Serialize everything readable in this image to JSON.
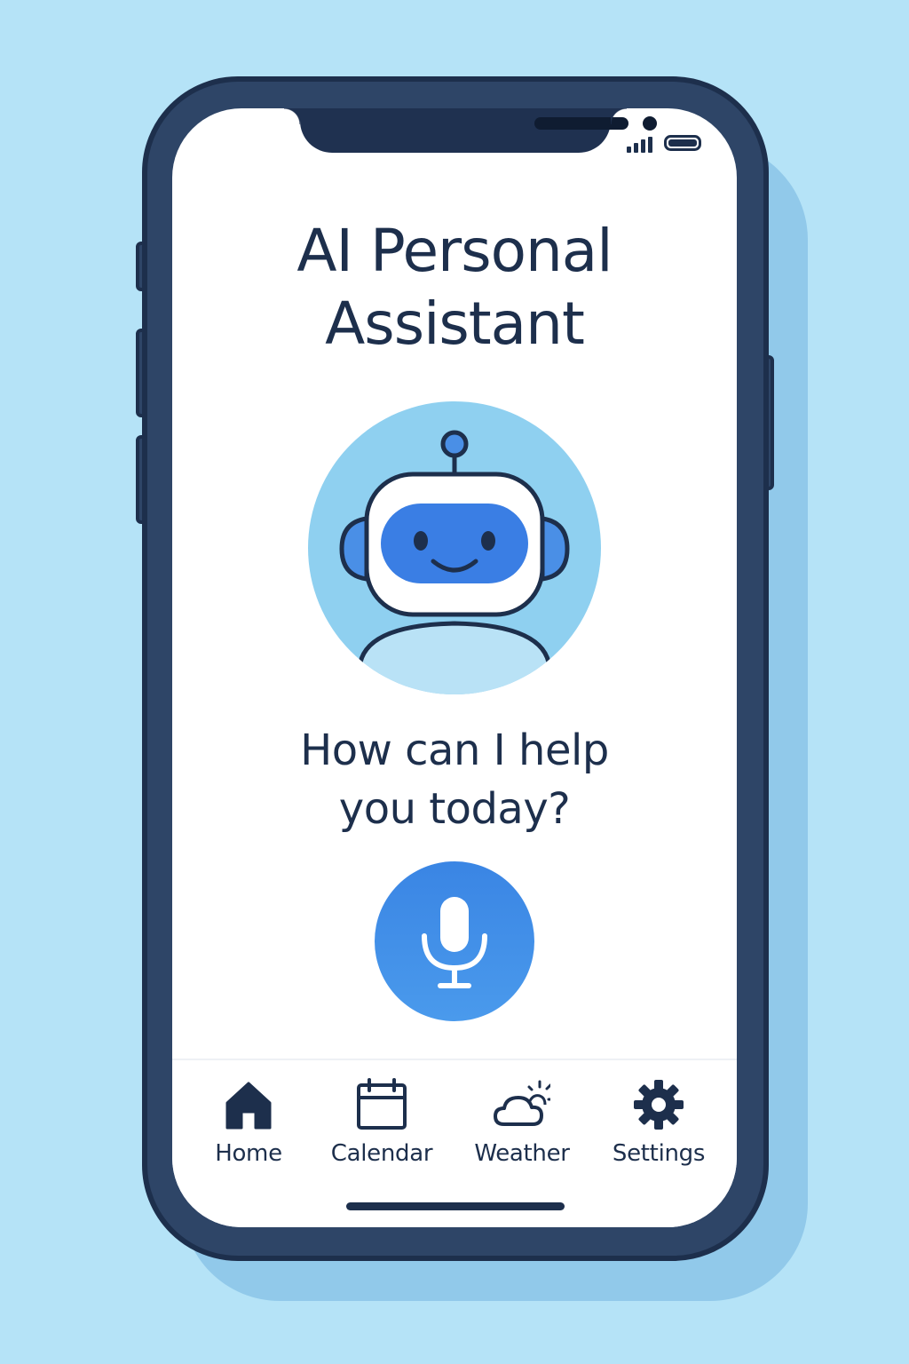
{
  "app": {
    "title_line1": "AI Personal",
    "title_line2": "Assistant"
  },
  "status_bar": {
    "signal_icon": "signal-icon",
    "battery_icon": "battery-icon"
  },
  "assistant": {
    "avatar_icon": "robot-avatar-icon",
    "prompt_line1": "How can I help",
    "prompt_line2": "you today?"
  },
  "mic": {
    "icon": "microphone-icon"
  },
  "nav": {
    "items": [
      {
        "label": "Home",
        "icon": "home-icon"
      },
      {
        "label": "Calendar",
        "icon": "calendar-icon"
      },
      {
        "label": "Weather",
        "icon": "weather-icon"
      },
      {
        "label": "Settings",
        "icon": "gear-icon"
      }
    ]
  },
  "colors": {
    "background": "#b5e3f7",
    "frame": "#2e4567",
    "text": "#1d2f4c",
    "accent": "#3a85e4",
    "avatar_circle": "#8fd0f0"
  }
}
